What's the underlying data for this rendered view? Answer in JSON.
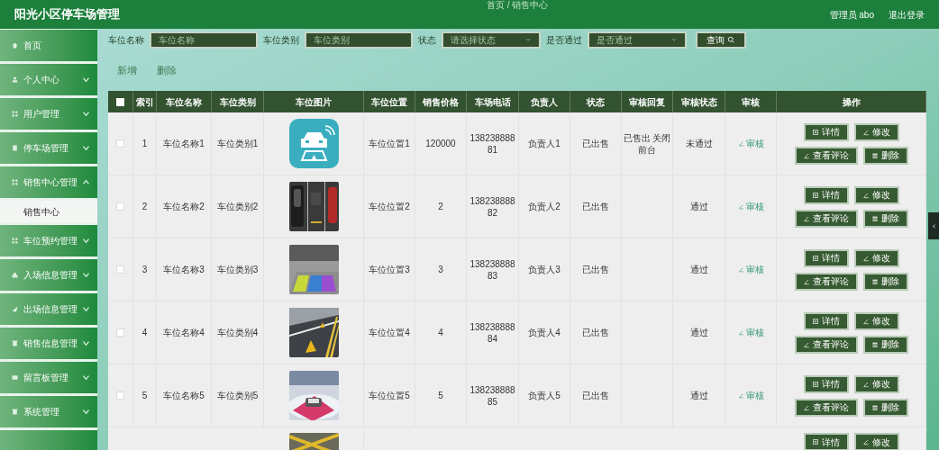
{
  "header": {
    "title": "阳光小区停车场管理",
    "breadcrumb": "首页 / 销售中心",
    "user": "管理员 abo",
    "logout": "退出登录"
  },
  "sidebar": {
    "items": [
      {
        "label": "首页"
      },
      {
        "label": "个人中心",
        "expanded": false
      },
      {
        "label": "用户管理",
        "expanded": false
      },
      {
        "label": "停车场管理",
        "expanded": false
      },
      {
        "label": "销售中心管理",
        "expanded": true,
        "children": [
          {
            "label": "销售中心",
            "selected": true
          }
        ]
      },
      {
        "label": "车位预约管理",
        "expanded": false
      },
      {
        "label": "入场信息管理",
        "expanded": false
      },
      {
        "label": "出场信息管理",
        "expanded": false
      },
      {
        "label": "销售信息管理",
        "expanded": false
      },
      {
        "label": "留言板管理",
        "expanded": false
      },
      {
        "label": "系统管理",
        "expanded": false
      }
    ]
  },
  "filters": [
    {
      "kind": "input",
      "label": "车位名称",
      "placeholder": "车位名称"
    },
    {
      "kind": "input",
      "label": "车位类别",
      "placeholder": "车位类别"
    },
    {
      "kind": "select",
      "label": "状态",
      "placeholder": "请选择状态"
    },
    {
      "kind": "select",
      "label": "是否通过",
      "placeholder": "是否通过"
    }
  ],
  "search_button": "查询",
  "actions": [
    "新增",
    "删除"
  ],
  "table": {
    "select_all": false,
    "columns": [
      "索引",
      "车位名称",
      "车位类别",
      "车位图片",
      "车位位置",
      "销售价格",
      "车场电话",
      "负责人",
      "状态",
      "审核回复",
      "审核状态",
      "审核",
      "操作"
    ],
    "rows": [
      {
        "checked": false,
        "index": "1",
        "name": "车位名称1",
        "category": "车位类别1",
        "location": "车位位置1",
        "price": "120000",
        "phone": "13823888881",
        "manager": "负责人1",
        "status": "已出售",
        "reply": "已售出 关闭前台",
        "review_status": "未通过",
        "review": "审核",
        "ops": [
          "详情",
          "修改",
          "查看评论",
          "删除"
        ]
      },
      {
        "checked": false,
        "index": "2",
        "name": "车位名称2",
        "category": "车位类别2",
        "location": "车位位置2",
        "price": "2",
        "phone": "13823888882",
        "manager": "负责人2",
        "status": "已出售",
        "review_status": "通过",
        "review": "审核",
        "ops": [
          "详情",
          "修改",
          "查看评论",
          "删除"
        ]
      },
      {
        "checked": false,
        "index": "3",
        "name": "车位名称3",
        "category": "车位类别3",
        "location": "车位位置3",
        "price": "3",
        "phone": "13823888883",
        "manager": "负责人3",
        "status": "已出售",
        "review_status": "通过",
        "review": "审核",
        "ops": [
          "详情",
          "修改",
          "查看评论",
          "删除"
        ]
      },
      {
        "checked": false,
        "index": "4",
        "name": "车位名称4",
        "category": "车位类别4",
        "location": "车位位置4",
        "price": "4",
        "phone": "13823888884",
        "manager": "负责人4",
        "status": "已出售",
        "review_status": "通过",
        "review": "审核",
        "ops": [
          "详情",
          "修改",
          "查看评论",
          "删除"
        ]
      },
      {
        "checked": false,
        "index": "5",
        "name": "车位名称5",
        "category": "车位类别5",
        "location": "车位位置5",
        "price": "5",
        "phone": "13823888885",
        "manager": "负责人5",
        "status": "已出售",
        "review_status": "通过",
        "review": "审核",
        "ops": [
          "详情",
          "修改",
          "查看评论",
          "删除"
        ]
      },
      {
        "ops": [
          "详情",
          "修改"
        ]
      }
    ]
  }
}
